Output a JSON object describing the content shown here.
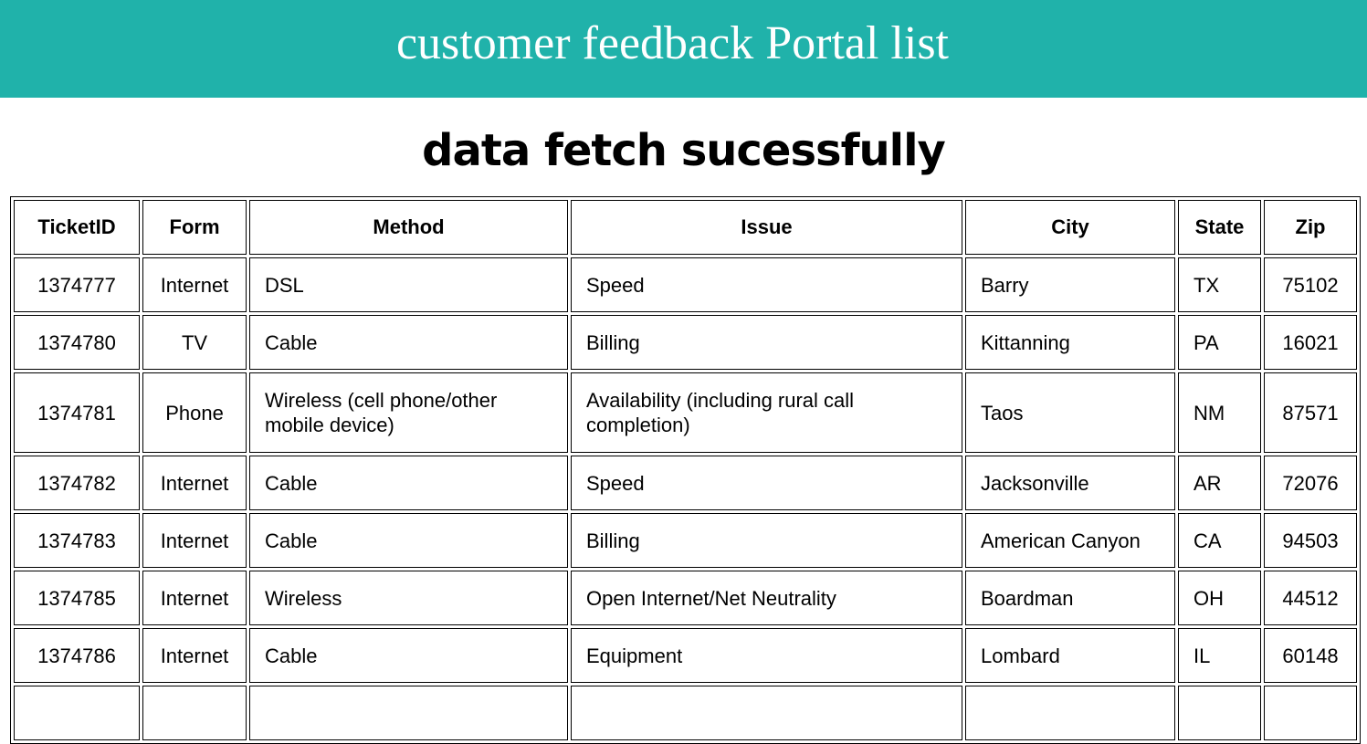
{
  "header": {
    "title": "customer feedback Portal list",
    "background_color": "#20b2aa",
    "text_color": "#ffffff"
  },
  "status_message": "data fetch sucessfully",
  "table": {
    "columns": [
      "TicketID",
      "Form",
      "Method",
      "Issue",
      "City",
      "State",
      "Zip"
    ],
    "rows": [
      [
        "1374777",
        "Internet",
        "DSL",
        "Speed",
        "Barry",
        "TX",
        "75102"
      ],
      [
        "1374780",
        "TV",
        "Cable",
        "Billing",
        "Kittanning",
        "PA",
        "16021"
      ],
      [
        "1374781",
        "Phone",
        "Wireless (cell phone/other mobile device)",
        "Availability (including rural call completion)",
        "Taos",
        "NM",
        "87571"
      ],
      [
        "1374782",
        "Internet",
        "Cable",
        "Speed",
        "Jacksonville",
        "AR",
        "72076"
      ],
      [
        "1374783",
        "Internet",
        "Cable",
        "Billing",
        "American Canyon",
        "CA",
        "94503"
      ],
      [
        "1374785",
        "Internet",
        "Wireless",
        "Open Internet/Net Neutrality",
        "Boardman",
        "OH",
        "44512"
      ],
      [
        "1374786",
        "Internet",
        "Cable",
        "Equipment",
        "Lombard",
        "IL",
        "60148"
      ],
      [
        "",
        "",
        "",
        "",
        "",
        "",
        ""
      ]
    ]
  }
}
